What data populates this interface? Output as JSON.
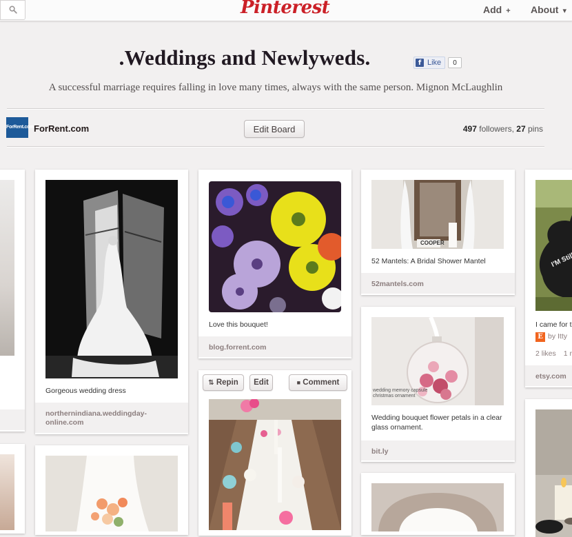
{
  "header": {
    "logo_text": "Pinterest",
    "add_label": "Add",
    "add_glyph": "+",
    "about_label": "About",
    "about_glyph": "▾",
    "search_icon": "search-icon"
  },
  "board": {
    "title": ".Weddings and Newlyweds.",
    "like_label": "Like",
    "like_count": "0",
    "description": "A successful marriage requires falling in love many times, always with the same person. Mignon McLaughlin",
    "owner_avatar_text": "ForRent.com",
    "owner_name": "ForRent.com",
    "edit_label": "Edit Board",
    "followers_count": "497",
    "followers_label": "followers,",
    "pins_count": "27",
    "pins_label": "pins"
  },
  "pins": {
    "col2_top": {
      "caption": "Gorgeous wedding dress",
      "source": "northernindiana.weddingday-online.com"
    },
    "col3_top": {
      "caption": "Love this bouquet!",
      "source": "blog.forrent.com"
    },
    "col3_hover": {
      "repin_label": "Repin",
      "edit_label": "Edit",
      "comment_label": "Comment"
    },
    "col4_top": {
      "caption": "52 Mantels: A Bridal Shower Mantel",
      "source": "52mantels.com",
      "sign_text": "COOPER"
    },
    "col4_mid": {
      "caption": "Wedding bouquet flower petals in a clear glass ornament.",
      "source": "bit.ly",
      "ornament_text": "wedding memory capsule christmas ornament"
    },
    "col5_top": {
      "caption": "I came for t",
      "by_text": "by Itty",
      "likes_text": "2 likes",
      "extra_text": "1 r",
      "source": "etsy.com",
      "sign_text": "I'M Still"
    }
  },
  "colors": {
    "brand": "#cb2027",
    "background": "#f2f0f0",
    "source_text": "#8c7e7e"
  }
}
